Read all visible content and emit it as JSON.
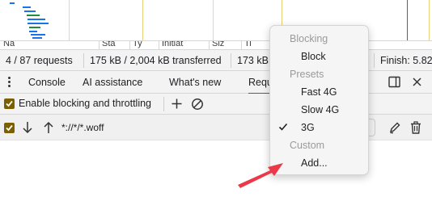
{
  "network": {
    "columns": [
      "Na",
      "Sta",
      "Ty",
      "Initiat",
      "Siz",
      "Ti"
    ],
    "summary": {
      "requests": "4 / 87 requests",
      "transferred": "175 kB / 2,004 kB transferred",
      "resources": "173 kB",
      "finish": "Finish: 5.82"
    }
  },
  "drawer": {
    "tabs": [
      "Console",
      "AI assistance",
      "What's new",
      "Requ"
    ],
    "active_tab_index": 3
  },
  "toolbar": {
    "enable_label": "Enable blocking and throttling",
    "enabled": true
  },
  "pattern_row": {
    "pattern": "*://*/*.woff",
    "enabled": true
  },
  "menu": {
    "group_blocking": "Blocking",
    "item_block": "Block",
    "group_presets": "Presets",
    "item_fast4g": "Fast 4G",
    "item_slow4g": "Slow 4G",
    "item_3g": "3G",
    "group_custom": "Custom",
    "item_add": "Add...",
    "selected": "3G"
  },
  "colors": {
    "accent": "#7a6000",
    "arrow": "#ea3a4a",
    "waterfall_blue": "#1a73e8",
    "waterfall_green": "#1e8e3e"
  },
  "icons": [
    "kebab-menu-icon",
    "dock-side-icon",
    "close-icon",
    "add-icon",
    "clear-icon",
    "arrow-down-icon",
    "arrow-up-icon",
    "edit-icon",
    "delete-icon",
    "checkmark-icon"
  ]
}
